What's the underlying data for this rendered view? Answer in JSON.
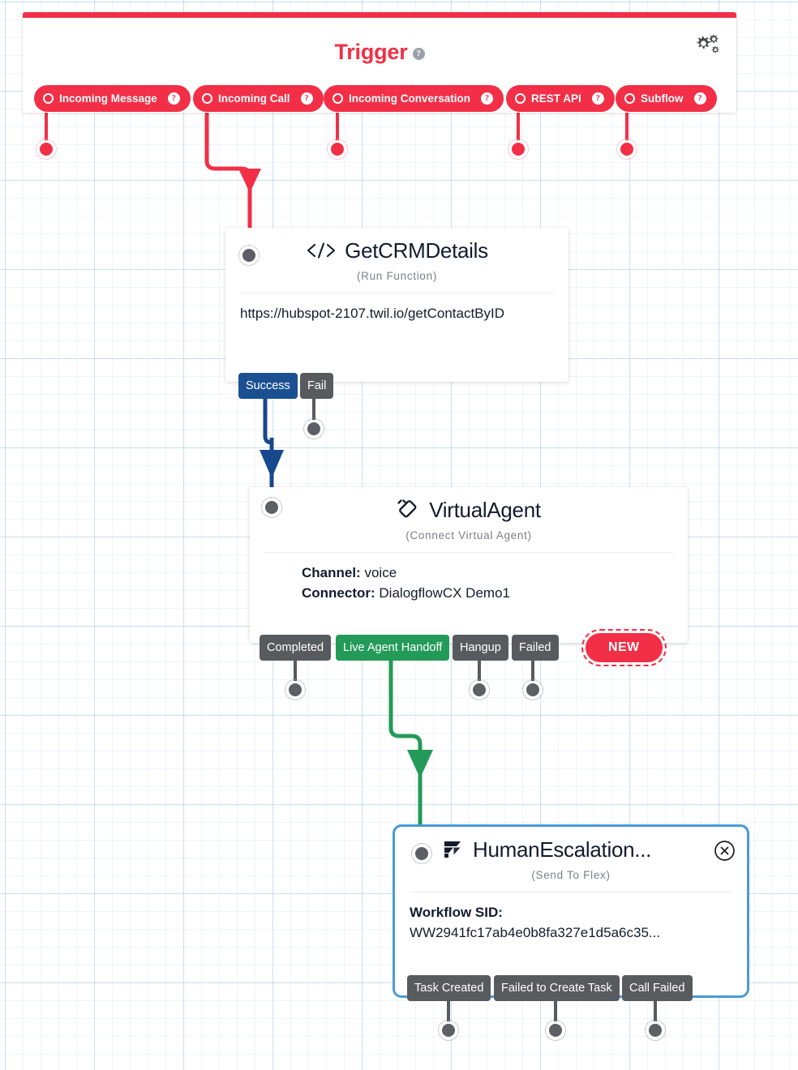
{
  "canvas": {
    "background_color": "#ffffff",
    "grid_color": "#8cbeeb"
  },
  "trigger": {
    "title": "Trigger",
    "help_badge": "?",
    "accent_color": "#f22f46",
    "settings_icon": "gears-icon",
    "pills": [
      {
        "label": "Incoming Message",
        "help": "?",
        "icon": "circle-outline-icon"
      },
      {
        "label": "Incoming Call",
        "help": "?",
        "icon": "circle-outline-icon"
      },
      {
        "label": "Incoming Conversation",
        "help": "?",
        "icon": "circle-outline-icon"
      },
      {
        "label": "REST API",
        "help": "?",
        "icon": "circle-outline-icon"
      },
      {
        "label": "Subflow",
        "help": "?",
        "icon": "circle-outline-icon"
      }
    ]
  },
  "nodes": [
    {
      "id": "getcrmdetails",
      "title": "GetCRMDetails",
      "subtitle": "(Run Function)",
      "icon": "code-brackets-icon",
      "body_text": "https://hubspot-2107.twil.io/getContactByID",
      "transitions": [
        {
          "label": "Success",
          "color": "#1a5091"
        },
        {
          "label": "Fail",
          "color": "#585b5e"
        }
      ]
    },
    {
      "id": "virtualagent",
      "title": "VirtualAgent",
      "subtitle": "(Connect Virtual Agent)",
      "icon": "phone-handset-icon",
      "fields": [
        {
          "key": "Channel:",
          "value": "voice"
        },
        {
          "key": "Connector:",
          "value": "DialogflowCX Demo1"
        }
      ],
      "transitions": [
        {
          "label": "Completed",
          "color": "#585b5e"
        },
        {
          "label": "Live Agent Handoff",
          "color": "#239a57"
        },
        {
          "label": "Hangup",
          "color": "#585b5e"
        },
        {
          "label": "Failed",
          "color": "#585b5e"
        }
      ],
      "badge": {
        "label": "NEW",
        "color": "#f22f46"
      }
    },
    {
      "id": "humanescalation",
      "title": "HumanEscalation...",
      "subtitle": "(Send To Flex)",
      "icon": "flex-logo-icon",
      "close_icon": "close-circle-icon",
      "selected": true,
      "selection_color": "#4a9ad4",
      "fields": [
        {
          "key": "Workflow SID:",
          "value": "WW2941fc17ab4e0b8fa327e1d5a6c35..."
        }
      ],
      "transitions": [
        {
          "label": "Task Created",
          "color": "#585b5e"
        },
        {
          "label": "Failed to Create Task",
          "color": "#585b5e"
        },
        {
          "label": "Call Failed",
          "color": "#585b5e"
        }
      ]
    }
  ],
  "connections": [
    {
      "from": "Incoming Call",
      "to": "GetCRMDetails",
      "color": "#f22f46"
    },
    {
      "from": "Success",
      "to": "VirtualAgent",
      "color": "#1a5091"
    },
    {
      "from": "Live Agent Handoff",
      "to": "HumanEscalation...",
      "color": "#239a57"
    }
  ]
}
